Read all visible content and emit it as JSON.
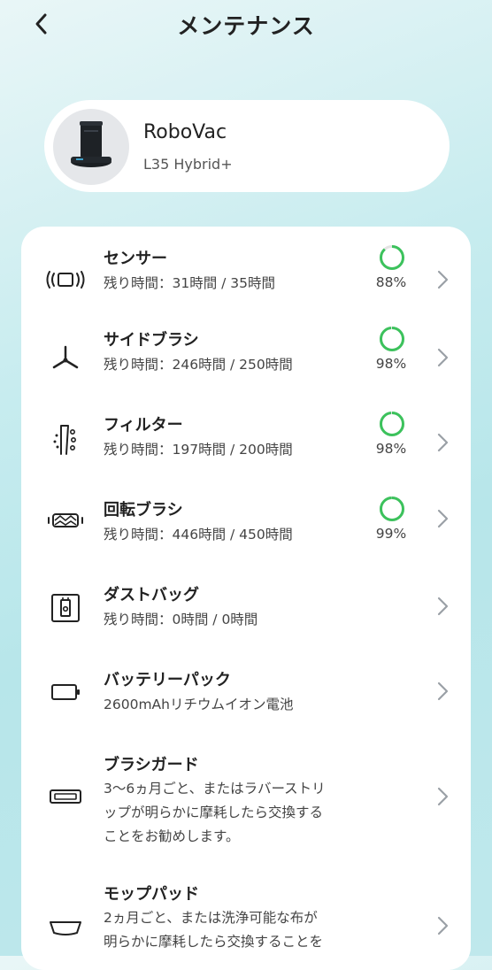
{
  "header": {
    "title": "メンテナンス",
    "back_icon": "chevron-left-icon"
  },
  "device": {
    "name": "RoboVac",
    "model": "L35 Hybrid+"
  },
  "colors": {
    "accent_green": "#3cc25c",
    "chevron": "#9aa0a6"
  },
  "items": [
    {
      "title": "センサー",
      "remaining": "残り時間：31時間 / 35時間",
      "percent": "88%",
      "percent_value": 88,
      "icon": "sensor-icon"
    },
    {
      "title": "サイドブラシ",
      "remaining": "残り時間：246時間 / 250時間",
      "percent": "98%",
      "percent_value": 98,
      "icon": "side-brush-icon"
    },
    {
      "title": "フィルター",
      "remaining": "残り時間：197時間 / 200時間",
      "percent": "98%",
      "percent_value": 98,
      "icon": "filter-icon"
    },
    {
      "title": "回転ブラシ",
      "remaining": "残り時間：446時間 / 450時間",
      "percent": "99%",
      "percent_value": 99,
      "icon": "rolling-brush-icon"
    },
    {
      "title": "ダストバッグ",
      "remaining": "残り時間：0時間 / 0時間",
      "icon": "dust-bag-icon"
    },
    {
      "title": "バッテリーパック",
      "remaining": "2600mAhリチウムイオン電池",
      "icon": "battery-icon"
    },
    {
      "title": "ブラシガード",
      "desc_lines": [
        "3〜6ヵ月ごと、またはラバーストリ",
        "ップが明らかに摩耗したら交換する",
        "ことをお勧めします。"
      ],
      "icon": "brush-guard-icon"
    },
    {
      "title": "モップパッド",
      "desc_lines": [
        "2ヵ月ごと、または洗浄可能な布が",
        "明らかに摩耗したら交換することを"
      ],
      "icon": "mop-pad-icon"
    }
  ]
}
